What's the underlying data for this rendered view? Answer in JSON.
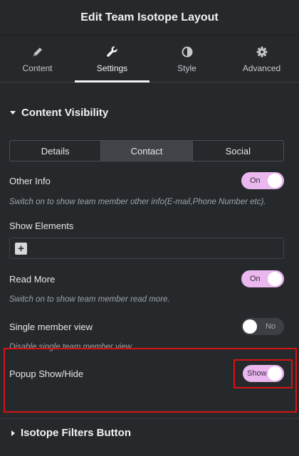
{
  "header": {
    "title": "Edit Team Isotope Layout"
  },
  "tabs": [
    {
      "label": "Content",
      "icon": "pencil-icon"
    },
    {
      "label": "Settings",
      "icon": "wrench-icon"
    },
    {
      "label": "Style",
      "icon": "half-circle-icon"
    },
    {
      "label": "Advanced",
      "icon": "gear-icon"
    }
  ],
  "section": {
    "title": "Content Visibility"
  },
  "segments": [
    "Details",
    "Contact",
    "Social"
  ],
  "other_info": {
    "label": "Other Info",
    "toggle": "On",
    "help": "Switch on to show team member other info(E-mail,Phone Number etc)."
  },
  "show_elements": {
    "label": "Show Elements",
    "add_icon": "+"
  },
  "read_more": {
    "label": "Read More",
    "toggle": "On",
    "help": "Switch on to show team member read more."
  },
  "single_view": {
    "label": "Single member view",
    "toggle": "No",
    "help": "Disable single team member view."
  },
  "popup": {
    "label": "Popup Show/Hide",
    "toggle": "Show"
  },
  "section2": {
    "title": "Isotope Filters Button"
  },
  "colors": {
    "toggle_on": "#eab8ee",
    "highlight": "#d41414",
    "background": "#26292c"
  }
}
